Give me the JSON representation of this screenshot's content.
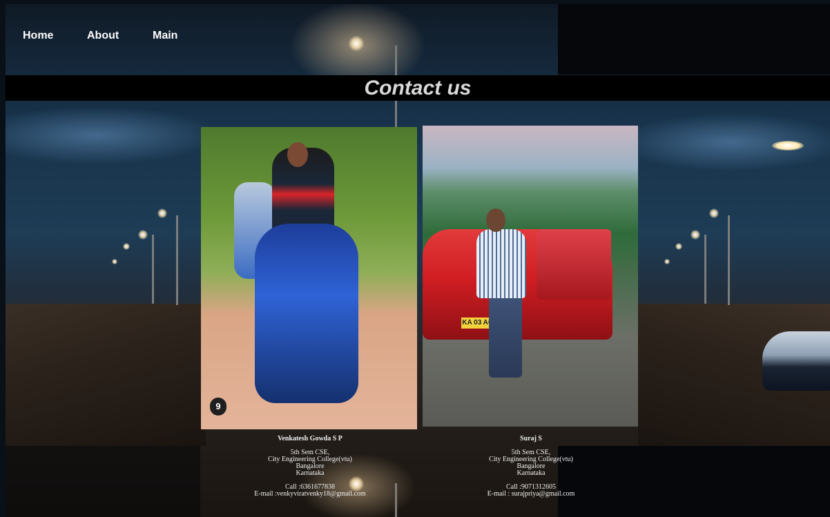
{
  "nav": {
    "home_label": "Home",
    "about_label": "About",
    "main_label": "Main"
  },
  "page": {
    "title": "Contact us"
  },
  "contacts": [
    {
      "name": "Venkatesh Gowda S P",
      "semester": "5th Sem CSE,",
      "college": "City Engineering College(vtu)",
      "city": "Bangalore",
      "state": "Karnataka",
      "call": "Call :6361677838",
      "email": "E-mail :venkyviratvenky18@gmail.com",
      "photo_badge": "9"
    },
    {
      "name": "Suraj S",
      "semester": "5th Sem CSE,",
      "college": "City Engineering College(vtu)",
      "city": "Bangalore",
      "state": "Karnataka",
      "call": "Call :9071312605",
      "email": "E-mail : surajpriya@gmail.com",
      "plate": "KA 03 AG"
    }
  ],
  "colors": {
    "title_bar": "#000000",
    "title_text": "#d9d9d9",
    "nav_text": "#ffffff"
  }
}
